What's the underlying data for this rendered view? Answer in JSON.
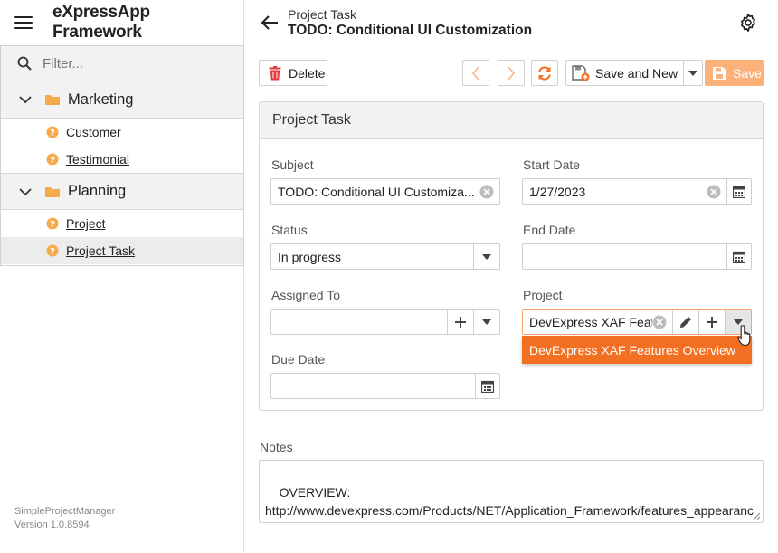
{
  "app": {
    "title": "eXpressApp Framework"
  },
  "nav": {
    "filter_placeholder": "Filter...",
    "groups": [
      {
        "label": "Marketing",
        "items": [
          {
            "label": "Customer"
          },
          {
            "label": "Testimonial"
          }
        ]
      },
      {
        "label": "Planning",
        "items": [
          {
            "label": "Project"
          },
          {
            "label": "Project Task",
            "selected": true
          }
        ]
      }
    ]
  },
  "footer": {
    "app_name": "SimpleProjectManager",
    "version": "Version 1.0.8594"
  },
  "view": {
    "caption": "Project Task",
    "title": "TODO: Conditional UI Customization"
  },
  "toolbar": {
    "delete_label": "Delete",
    "save_and_new_label": "Save and New",
    "save_label": "Save"
  },
  "form": {
    "section_title": "Project Task",
    "subject": {
      "label": "Subject",
      "value": "TODO: Conditional UI Customiza..."
    },
    "start_date": {
      "label": "Start Date",
      "value": "1/27/2023"
    },
    "status": {
      "label": "Status",
      "value": "In progress"
    },
    "end_date": {
      "label": "End Date",
      "value": ""
    },
    "assigned_to": {
      "label": "Assigned To",
      "value": ""
    },
    "project": {
      "label": "Project",
      "value": "DevExpress XAF Feat"
    },
    "due_date": {
      "label": "Due Date",
      "value": ""
    }
  },
  "project_dropdown": {
    "options": [
      "DevExpress XAF Features Overview"
    ]
  },
  "notes": {
    "label": "Notes",
    "value": "OVERVIEW:\nhttp://www.devexpress.com/Products/NET/Application_Framework/features_appearance.xml"
  },
  "colors": {
    "accent": "#f36f21",
    "save_button": "#fbb27a",
    "delete_icon": "#e03a3a"
  }
}
